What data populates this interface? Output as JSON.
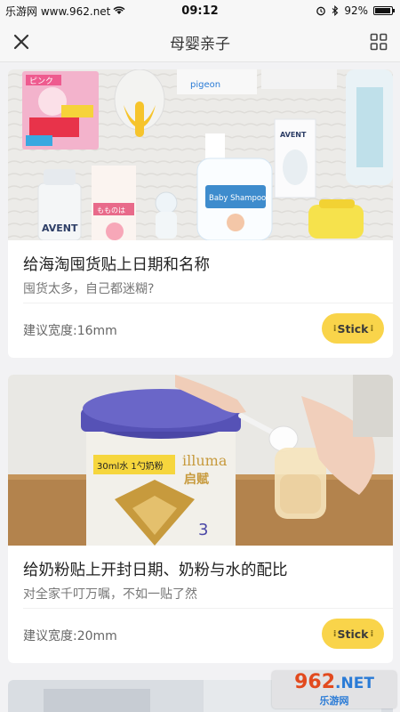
{
  "status_bar": {
    "carrier": "乐游网 www.962.net",
    "time": "09:12",
    "battery": "92%",
    "battery_level": 0.92,
    "icons": [
      "wifi-icon",
      "alarm-icon",
      "bluetooth-icon",
      "battery-icon"
    ]
  },
  "nav": {
    "title": "母婴亲子",
    "close_icon": "close-icon",
    "menu_icon": "grid-icon"
  },
  "cards": [
    {
      "title": "给海淘囤货贴上日期和名称",
      "subtitle": "囤货太多，自己都迷糊?",
      "width_label": "建议宽度:16mm",
      "button": "Stick",
      "photo_labels": {
        "box1": "ピンク",
        "box2": "pigeon",
        "box3": "もものは",
        "bottle1": "AVENT",
        "wash": "Baby Shampoo",
        "bottle2": "AVENT"
      }
    },
    {
      "title": "给奶粉贴上开封日期、奶粉与水的配比",
      "subtitle": "对全家千叮万嘱，不如一贴了然",
      "width_label": "建议宽度:20mm",
      "button": "Stick",
      "photo_labels": {
        "sticker": "30ml水 1勺奶粉",
        "brand": "illuma",
        "brand_cn": "启赋",
        "stage": "3"
      }
    }
  ],
  "watermark": {
    "top": "962",
    "suffix": ".NET",
    "bottom": "乐游网"
  },
  "colors": {
    "accent_button": "#f9d44a",
    "background": "#f2f2f4",
    "watermark_red": "#e24a1e",
    "watermark_blue": "#2a7bd6"
  }
}
